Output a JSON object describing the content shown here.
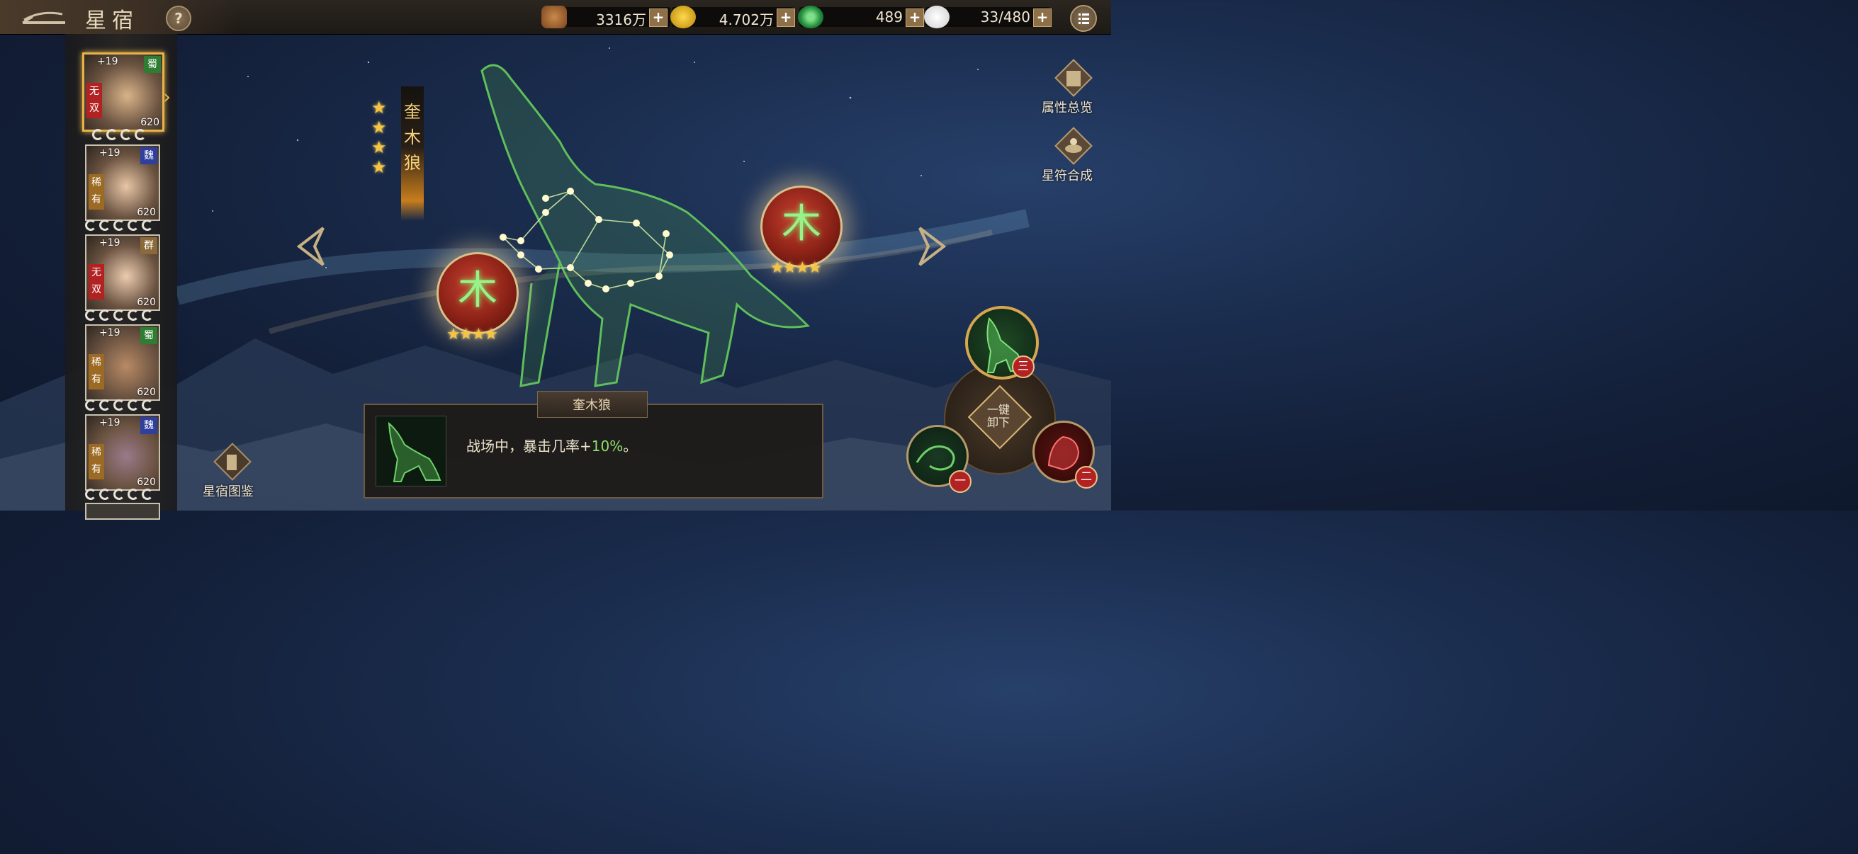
{
  "header": {
    "title": "星宿",
    "help_label": "?",
    "resources": [
      {
        "icon": "copper-coins-icon",
        "value": "3316万"
      },
      {
        "icon": "gold-coin-icon",
        "value": "4.702万"
      },
      {
        "icon": "jade-icon",
        "value": "489"
      },
      {
        "icon": "steamed-bun-icon",
        "value": "33/480"
      }
    ],
    "plus_label": "+"
  },
  "heroes": [
    {
      "level": "+19",
      "faction": "蜀",
      "faction_color": "#2e7d32",
      "rarity": "无双",
      "rarity_color": "#b22222",
      "power": "620",
      "selected": true
    },
    {
      "level": "+19",
      "faction": "魏",
      "faction_color": "#2f3f9e",
      "rarity": "稀有",
      "rarity_color": "#9c6a22",
      "power": "620",
      "selected": false
    },
    {
      "level": "+19",
      "faction": "群",
      "faction_color": "#8a6a3a",
      "rarity": "无双",
      "rarity_color": "#b22222",
      "power": "620",
      "selected": false
    },
    {
      "level": "+19",
      "faction": "蜀",
      "faction_color": "#2e7d32",
      "rarity": "稀有",
      "rarity_color": "#9c6a22",
      "power": "620",
      "selected": false
    },
    {
      "level": "+19",
      "faction": "魏",
      "faction_color": "#2f3f9e",
      "rarity": "稀有",
      "rarity_color": "#9c6a22",
      "power": "620",
      "selected": false
    }
  ],
  "constellation": {
    "name": "奎木狼",
    "name_chars": [
      "奎",
      "木",
      "狼"
    ],
    "stars": "★★★★",
    "orb_glyph": "木"
  },
  "side_buttons": {
    "overview_label": "属性总览",
    "synthesis_label": "星符合成",
    "gallery_label": "星宿图鉴"
  },
  "description": {
    "title": "奎木狼",
    "text_prefix": "战场中，暴击几率+",
    "value": "10%",
    "text_suffix": "。"
  },
  "slots": {
    "unload_line1": "一键",
    "unload_line2": "卸下",
    "top_num": "三",
    "left_num": "一",
    "right_num": "二"
  }
}
